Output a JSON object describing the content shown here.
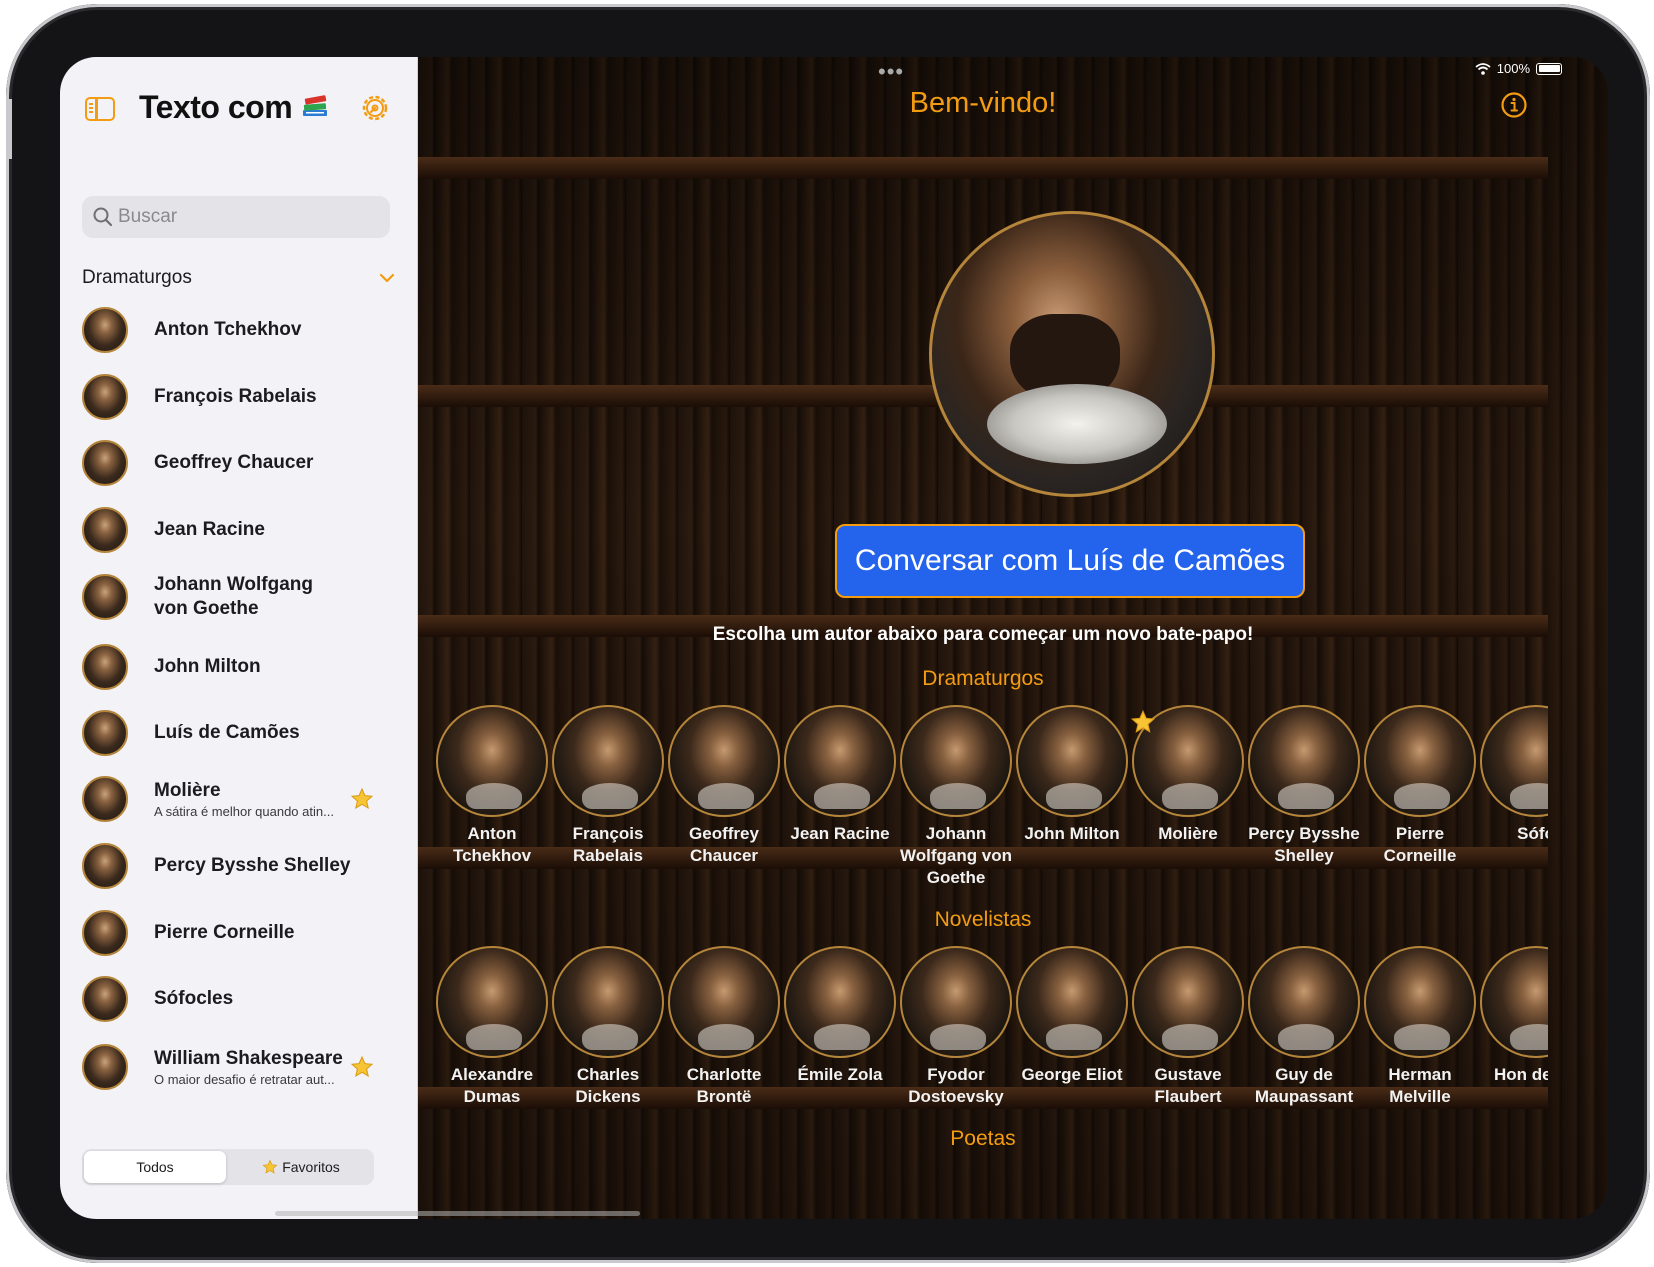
{
  "sidebar": {
    "title": "Texto com",
    "title_emoji": "books-emoji",
    "search_placeholder": "Buscar",
    "section": "Dramaturgos",
    "items": [
      {
        "name": "Anton Tchekhov",
        "subtitle": "",
        "favorite": false
      },
      {
        "name": "François Rabelais",
        "subtitle": "",
        "favorite": false
      },
      {
        "name": "Geoffrey Chaucer",
        "subtitle": "",
        "favorite": false
      },
      {
        "name": "Jean Racine",
        "subtitle": "",
        "favorite": false
      },
      {
        "name": "Johann Wolfgang von Goethe",
        "subtitle": "",
        "favorite": false
      },
      {
        "name": "John Milton",
        "subtitle": "",
        "favorite": false
      },
      {
        "name": "Luís de Camões",
        "subtitle": "",
        "favorite": false
      },
      {
        "name": "Molière",
        "subtitle": "A sátira é melhor quando atin...",
        "favorite": true
      },
      {
        "name": "Percy Bysshe Shelley",
        "subtitle": "",
        "favorite": false
      },
      {
        "name": "Pierre Corneille",
        "subtitle": "",
        "favorite": false
      },
      {
        "name": "Sófocles",
        "subtitle": "",
        "favorite": false
      },
      {
        "name": "William Shakespeare",
        "subtitle": "O maior desafio é retratar aut...",
        "favorite": true
      }
    ],
    "segments": {
      "all": "Todos",
      "favorites": "Favoritos"
    }
  },
  "status_bar": {
    "battery": "100%"
  },
  "main": {
    "welcome": "Bem-vindo!",
    "cta": "Conversar com Luís de Camões",
    "subtitle": "Escolha um autor abaixo para começar um novo bate-papo!",
    "sections": [
      {
        "title": "Dramaturgos",
        "authors": [
          {
            "name": "Anton Tchekhov",
            "favorite": false
          },
          {
            "name": "François Rabelais",
            "favorite": false
          },
          {
            "name": "Geoffrey Chaucer",
            "favorite": false
          },
          {
            "name": "Jean Racine",
            "favorite": false
          },
          {
            "name": "Johann Wolfgang von Goethe",
            "favorite": false
          },
          {
            "name": "John Milton",
            "favorite": false
          },
          {
            "name": "Molière",
            "favorite": true
          },
          {
            "name": "Percy Bysshe Shelley",
            "favorite": false
          },
          {
            "name": "Pierre Corneille",
            "favorite": false
          },
          {
            "name": "Sófo",
            "favorite": false
          }
        ]
      },
      {
        "title": "Novelistas",
        "authors": [
          {
            "name": "Alexandre Dumas",
            "favorite": false
          },
          {
            "name": "Charles Dickens",
            "favorite": false
          },
          {
            "name": "Charlotte Brontë",
            "favorite": false
          },
          {
            "name": "Émile Zola",
            "favorite": false
          },
          {
            "name": "Fyodor Dostoevsky",
            "favorite": false
          },
          {
            "name": "George Eliot",
            "favorite": false
          },
          {
            "name": "Gustave Flaubert",
            "favorite": false
          },
          {
            "name": "Guy de Maupassant",
            "favorite": false
          },
          {
            "name": "Herman Melville",
            "favorite": false
          },
          {
            "name": "Hon de Ba",
            "favorite": false
          }
        ]
      },
      {
        "title": "Poetas",
        "authors": []
      }
    ]
  },
  "colors": {
    "accent": "#f39c12",
    "cta": "#2463eb",
    "sidebar_bg": "#f2f2f7"
  }
}
